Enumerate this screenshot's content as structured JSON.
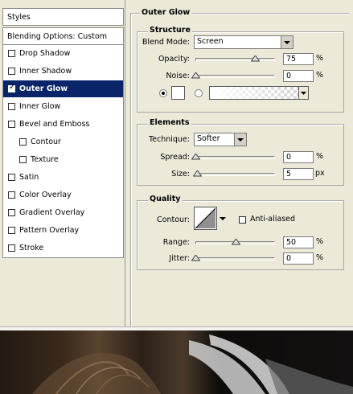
{
  "styles_panel": {
    "header": "Styles",
    "blending": "Blending Options: Custom",
    "items": [
      {
        "label": "Drop Shadow",
        "checked": false,
        "selected": false,
        "indent": false
      },
      {
        "label": "Inner Shadow",
        "checked": false,
        "selected": false,
        "indent": false
      },
      {
        "label": "Outer Glow",
        "checked": true,
        "selected": true,
        "indent": false
      },
      {
        "label": "Inner Glow",
        "checked": false,
        "selected": false,
        "indent": false
      },
      {
        "label": "Bevel and Emboss",
        "checked": false,
        "selected": false,
        "indent": false
      },
      {
        "label": "Contour",
        "checked": false,
        "selected": false,
        "indent": true
      },
      {
        "label": "Texture",
        "checked": false,
        "selected": false,
        "indent": true
      },
      {
        "label": "Satin",
        "checked": false,
        "selected": false,
        "indent": false
      },
      {
        "label": "Color Overlay",
        "checked": false,
        "selected": false,
        "indent": false
      },
      {
        "label": "Gradient Overlay",
        "checked": false,
        "selected": false,
        "indent": false
      },
      {
        "label": "Pattern Overlay",
        "checked": false,
        "selected": false,
        "indent": false
      },
      {
        "label": "Stroke",
        "checked": false,
        "selected": false,
        "indent": false
      }
    ]
  },
  "outer_glow": {
    "title": "Outer Glow",
    "structure": {
      "title": "Structure",
      "blend_mode_label": "Blend Mode:",
      "blend_mode_value": "Screen",
      "opacity_label": "Opacity:",
      "opacity_value": "75",
      "opacity_level": 0.75,
      "noise_label": "Noise:",
      "noise_value": "0",
      "noise_level": 0,
      "percent": "%"
    },
    "elements": {
      "title": "Elements",
      "technique_label": "Technique:",
      "technique_value": "Softer",
      "spread_label": "Spread:",
      "spread_value": "0",
      "spread_level": 0,
      "size_label": "Size:",
      "size_value": "5",
      "size_level": 0.02,
      "percent": "%",
      "px": "px"
    },
    "quality": {
      "title": "Quality",
      "contour_label": "Contour:",
      "antialiased_label": "Anti-aliased",
      "range_label": "Range:",
      "range_value": "50",
      "range_level": 0.5,
      "jitter_label": "Jitter:",
      "jitter_value": "0",
      "jitter_level": 0,
      "percent": "%"
    }
  },
  "colors": {
    "selection": "#0a246a",
    "panel_bg": "#ece9d8"
  }
}
